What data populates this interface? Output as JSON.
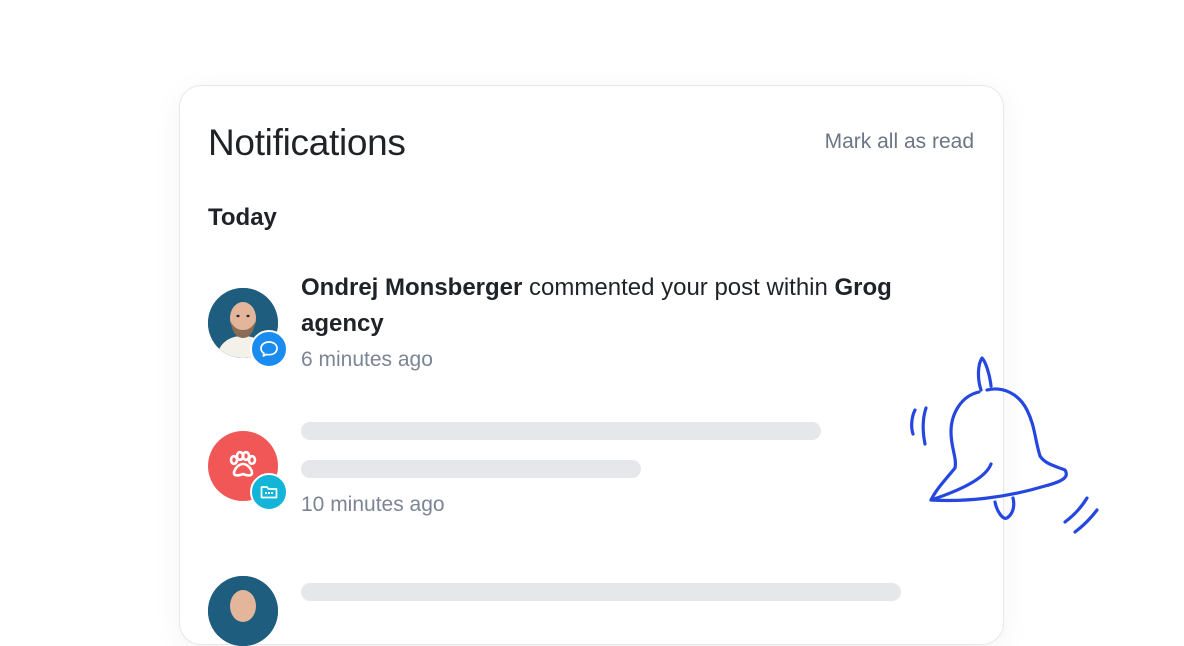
{
  "header": {
    "title": "Notifications",
    "mark_all": "Mark all as read"
  },
  "section_today": "Today",
  "notifications": [
    {
      "user": "Ondrej Monsberger",
      "action": " commented your post within ",
      "target": "Grog agency",
      "time": "6 minutes ago",
      "badge_icon": "chat-bubble-icon",
      "badge_color": "#1a8cf0"
    },
    {
      "time": "10 minutes ago",
      "avatar_icon": "paw-icon",
      "avatar_color": "#f25757",
      "badge_icon": "folder-icon",
      "badge_color": "#12b5d8"
    }
  ],
  "colors": {
    "accent_blue": "#2547e0",
    "skeleton": "#e5e7eb",
    "muted_text": "#7b8594"
  }
}
